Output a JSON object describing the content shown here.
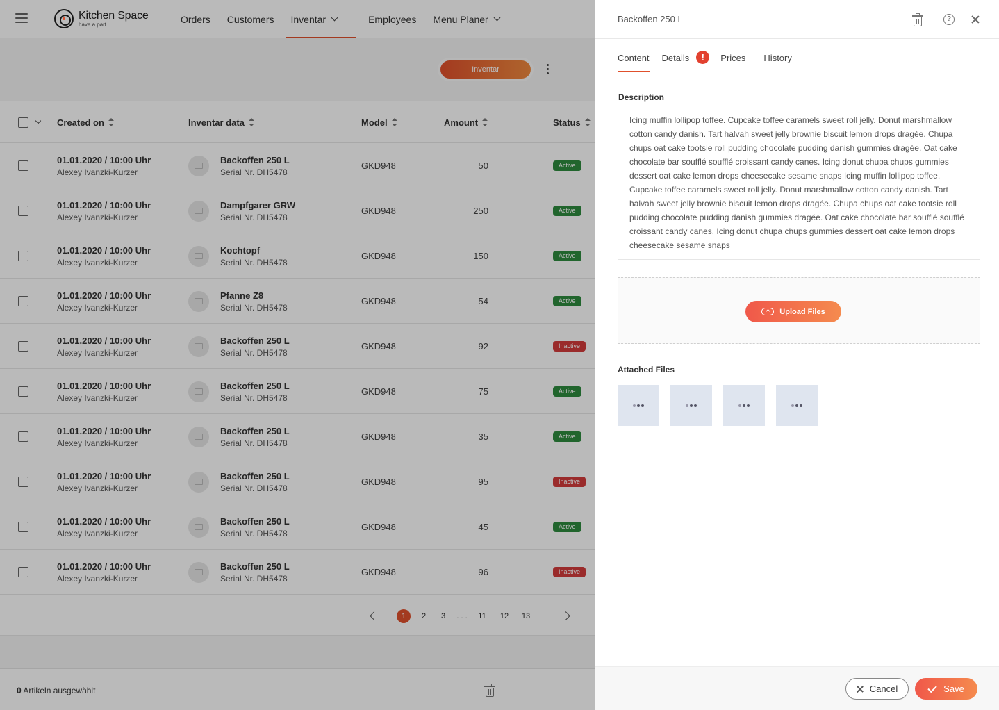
{
  "app": {
    "logo_title": "Kitchen Space",
    "logo_subtitle": "have a part",
    "nav": [
      {
        "label": "Orders"
      },
      {
        "label": "Customers"
      },
      {
        "label": "Inventar"
      },
      {
        "label": "Employees"
      },
      {
        "label": "Menu Planer"
      }
    ],
    "action_button": "Inventar",
    "accent_color": "#e0502c"
  },
  "table": {
    "headers": {
      "created_on": "Created on",
      "inventar_data": "Inventar data",
      "model": "Model",
      "amount": "Amount",
      "status": "Status"
    },
    "rows": [
      {
        "date": "01.01.2020  /  10:00 Uhr",
        "user": "Alexey Ivanzki-Kurzer",
        "name": "Backoffen 250 L",
        "serial": "Serial Nr. DH5478",
        "model": "GKD948",
        "amount": "50",
        "status": "Active"
      },
      {
        "date": "01.01.2020  /  10:00 Uhr",
        "user": "Alexey Ivanzki-Kurzer",
        "name": "Dampfgarer GRW",
        "serial": "Serial Nr. DH5478",
        "model": "GKD948",
        "amount": "250",
        "status": "Active"
      },
      {
        "date": "01.01.2020  /  10:00 Uhr",
        "user": "Alexey Ivanzki-Kurzer",
        "name": "Kochtopf",
        "serial": "Serial Nr. DH5478",
        "model": "GKD948",
        "amount": "150",
        "status": "Active"
      },
      {
        "date": "01.01.2020  /  10:00 Uhr",
        "user": "Alexey Ivanzki-Kurzer",
        "name": "Pfanne Z8",
        "serial": "Serial Nr. DH5478",
        "model": "GKD948",
        "amount": "54",
        "status": "Active"
      },
      {
        "date": "01.01.2020  /  10:00 Uhr",
        "user": "Alexey Ivanzki-Kurzer",
        "name": "Backoffen 250 L",
        "serial": "Serial Nr. DH5478",
        "model": "GKD948",
        "amount": "92",
        "status": "Inactive"
      },
      {
        "date": "01.01.2020  /  10:00 Uhr",
        "user": "Alexey Ivanzki-Kurzer",
        "name": "Backoffen 250 L",
        "serial": "Serial Nr. DH5478",
        "model": "GKD948",
        "amount": "75",
        "status": "Active"
      },
      {
        "date": "01.01.2020  /  10:00 Uhr",
        "user": "Alexey Ivanzki-Kurzer",
        "name": "Backoffen 250 L",
        "serial": "Serial Nr. DH5478",
        "model": "GKD948",
        "amount": "35",
        "status": "Active"
      },
      {
        "date": "01.01.2020  /  10:00 Uhr",
        "user": "Alexey Ivanzki-Kurzer",
        "name": "Backoffen 250 L",
        "serial": "Serial Nr. DH5478",
        "model": "GKD948",
        "amount": "95",
        "status": "Inactive"
      },
      {
        "date": "01.01.2020  /  10:00 Uhr",
        "user": "Alexey Ivanzki-Kurzer",
        "name": "Backoffen 250 L",
        "serial": "Serial Nr. DH5478",
        "model": "GKD948",
        "amount": "45",
        "status": "Active"
      },
      {
        "date": "01.01.2020  /  10:00 Uhr",
        "user": "Alexey Ivanzki-Kurzer",
        "name": "Backoffen 250 L",
        "serial": "Serial Nr. DH5478",
        "model": "GKD948",
        "amount": "96",
        "status": "Inactive"
      }
    ]
  },
  "pagination": {
    "pages": [
      "1",
      "2",
      "3",
      ". . .",
      "11",
      "12",
      "13"
    ],
    "current": "1"
  },
  "footer": {
    "selected_count": "0",
    "selected_label": " Artikeln ausgewählt"
  },
  "drawer": {
    "title": "Backoffen 250 L",
    "help_glyph": "?",
    "tabs": [
      {
        "label": "Content"
      },
      {
        "label": "Details"
      },
      {
        "label": "Prices"
      },
      {
        "label": "History"
      }
    ],
    "warning_glyph": "!",
    "description_label": "Description",
    "description_text": "Icing muffin lollipop toffee. Cupcake toffee caramels sweet roll jelly. Donut marshmallow cotton candy danish. Tart halvah sweet jelly brownie biscuit lemon drops dragée. Chupa chups oat cake tootsie roll pudding chocolate pudding danish gummies dragée. Oat cake chocolate bar soufflé soufflé croissant candy canes. Icing donut chupa chups gummies dessert oat cake lemon drops cheesecake sesame snaps Icing muffin lollipop toffee. Cupcake toffee caramels sweet roll jelly. Donut marshmallow cotton candy danish. Tart halvah sweet jelly brownie biscuit lemon drops dragée. Chupa chups oat cake tootsie roll pudding chocolate pudding danish gummies dragée. Oat cake chocolate bar soufflé soufflé croissant candy canes. Icing donut chupa chups gummies dessert oat cake lemon drops cheesecake sesame snaps",
    "upload_label": "Upload Files",
    "attached_label": "Attached Files",
    "cancel_label": "Cancel",
    "save_label": "Save"
  }
}
